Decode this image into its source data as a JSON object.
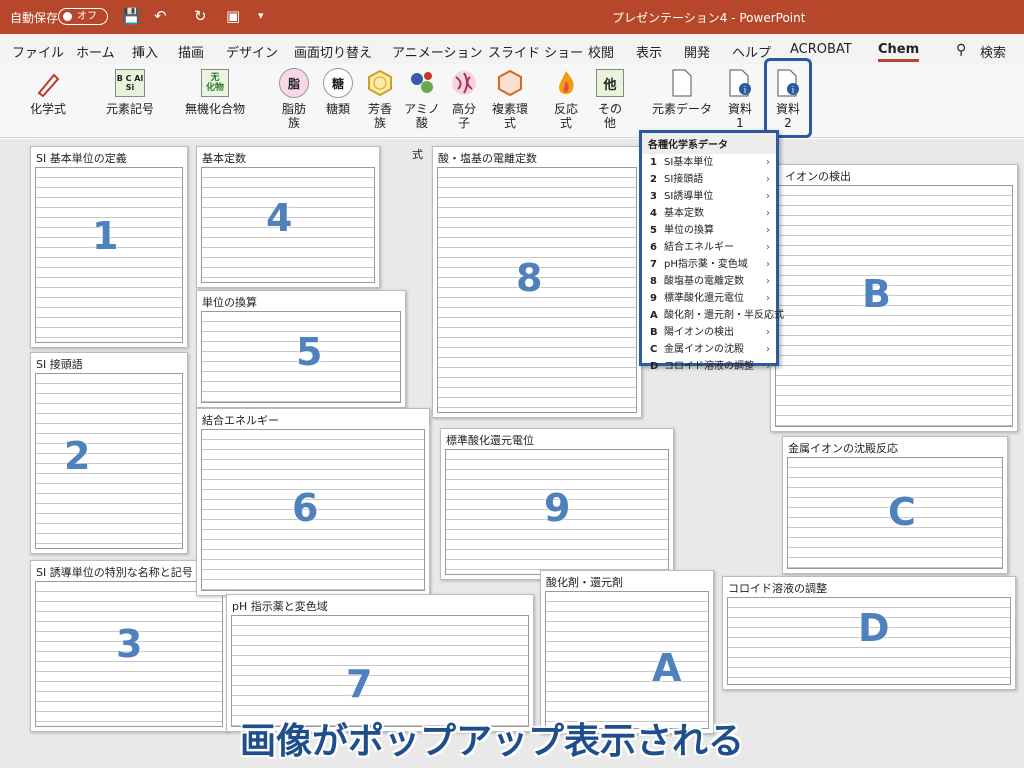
{
  "titlebar": {
    "autosave": "自動保存",
    "autosave_state": "オフ",
    "document_title": "プレゼンテーション4 - PowerPoint"
  },
  "tabs": [
    {
      "label": "ファイル"
    },
    {
      "label": "ホーム"
    },
    {
      "label": "挿入"
    },
    {
      "label": "描画"
    },
    {
      "label": "デザイン"
    },
    {
      "label": "画面切り替え"
    },
    {
      "label": "アニメーション"
    },
    {
      "label": "スライド ショー"
    },
    {
      "label": "校閲"
    },
    {
      "label": "表示"
    },
    {
      "label": "開発"
    },
    {
      "label": "ヘルプ"
    },
    {
      "label": "ACROBAT"
    },
    {
      "label": "Chem"
    }
  ],
  "search_label": "検索",
  "ribbon": {
    "chemical_formula": "化学式",
    "element_symbol": "元素記号",
    "element_symbol_icon": "B C Al Si",
    "inorganic": "無機化合物",
    "inorganic_icon_top": "无",
    "inorganic_icon_bottom": "化物",
    "fat_line1": "脂肪",
    "fat_line2": "族",
    "fat_icon": "脂",
    "sugar": "糖類",
    "sugar_icon": "糖",
    "aromatic_line1": "芳香",
    "aromatic_line2": "族",
    "amino_line1": "アミノ",
    "amino_line2": "酸",
    "polymer_line1": "高分",
    "polymer_line2": "子",
    "heterocycle_line1": "複素環",
    "heterocycle_line2": "式",
    "reaction_line1": "反応",
    "reaction_line2": "式",
    "other_line1": "その",
    "other_line2": "他",
    "other_icon": "他",
    "element_data": "元素データ",
    "material1_line1": "資料",
    "material1_line2": "1",
    "material2_line1": "資料",
    "material2_line2": "2"
  },
  "menu": {
    "header": "各種化学系データ",
    "items": [
      {
        "key": "1",
        "label": "SI基本単位"
      },
      {
        "key": "2",
        "label": "SI接頭語"
      },
      {
        "key": "3",
        "label": "SI誘導単位"
      },
      {
        "key": "4",
        "label": "基本定数"
      },
      {
        "key": "5",
        "label": "単位の換算"
      },
      {
        "key": "6",
        "label": "結合エネルギー"
      },
      {
        "key": "7",
        "label": "pH指示薬・変色域"
      },
      {
        "key": "8",
        "label": "酸塩基の電離定数"
      },
      {
        "key": "9",
        "label": "標準酸化還元電位"
      },
      {
        "key": "A",
        "label": "酸化剤・還元剤・半反応式"
      },
      {
        "key": "B",
        "label": "陽イオンの検出"
      },
      {
        "key": "C",
        "label": "金属イオンの沈殿"
      },
      {
        "key": "D",
        "label": "コロイド溶液の調整"
      }
    ]
  },
  "sheets": {
    "s1": {
      "title": "SI 基本単位の定義",
      "num": "1"
    },
    "s2": {
      "title": "SI 接頭語",
      "num": "2"
    },
    "s3": {
      "title": "SI 誘導単位の特別な名称と記号",
      "num": "3"
    },
    "s4": {
      "title": "基本定数",
      "num": "4"
    },
    "s5": {
      "title": "単位の換算",
      "num": "5"
    },
    "s6": {
      "title": "結合エネルギー",
      "num": "6"
    },
    "s7": {
      "title": "pH 指示薬と変色域",
      "num": "7"
    },
    "s8": {
      "title": "酸・塩基の電離定数",
      "num": "8"
    },
    "s9": {
      "title": "標準酸化還元電位",
      "num": "9"
    },
    "sA": {
      "title": "酸化剤・還元剤",
      "num": "A"
    },
    "sB": {
      "title": "イオンの検出",
      "num": "B"
    },
    "sC": {
      "title": "金属イオンの沈殿反応",
      "num": "C"
    },
    "sD": {
      "title": "コロイド溶液の調整",
      "num": "D"
    }
  },
  "partial_text": "式",
  "caption": "画像がポップアップ表示される",
  "colors": {
    "brand": "#b7472a",
    "highlight": "#2c5aa0",
    "number": "#4f81bd"
  }
}
